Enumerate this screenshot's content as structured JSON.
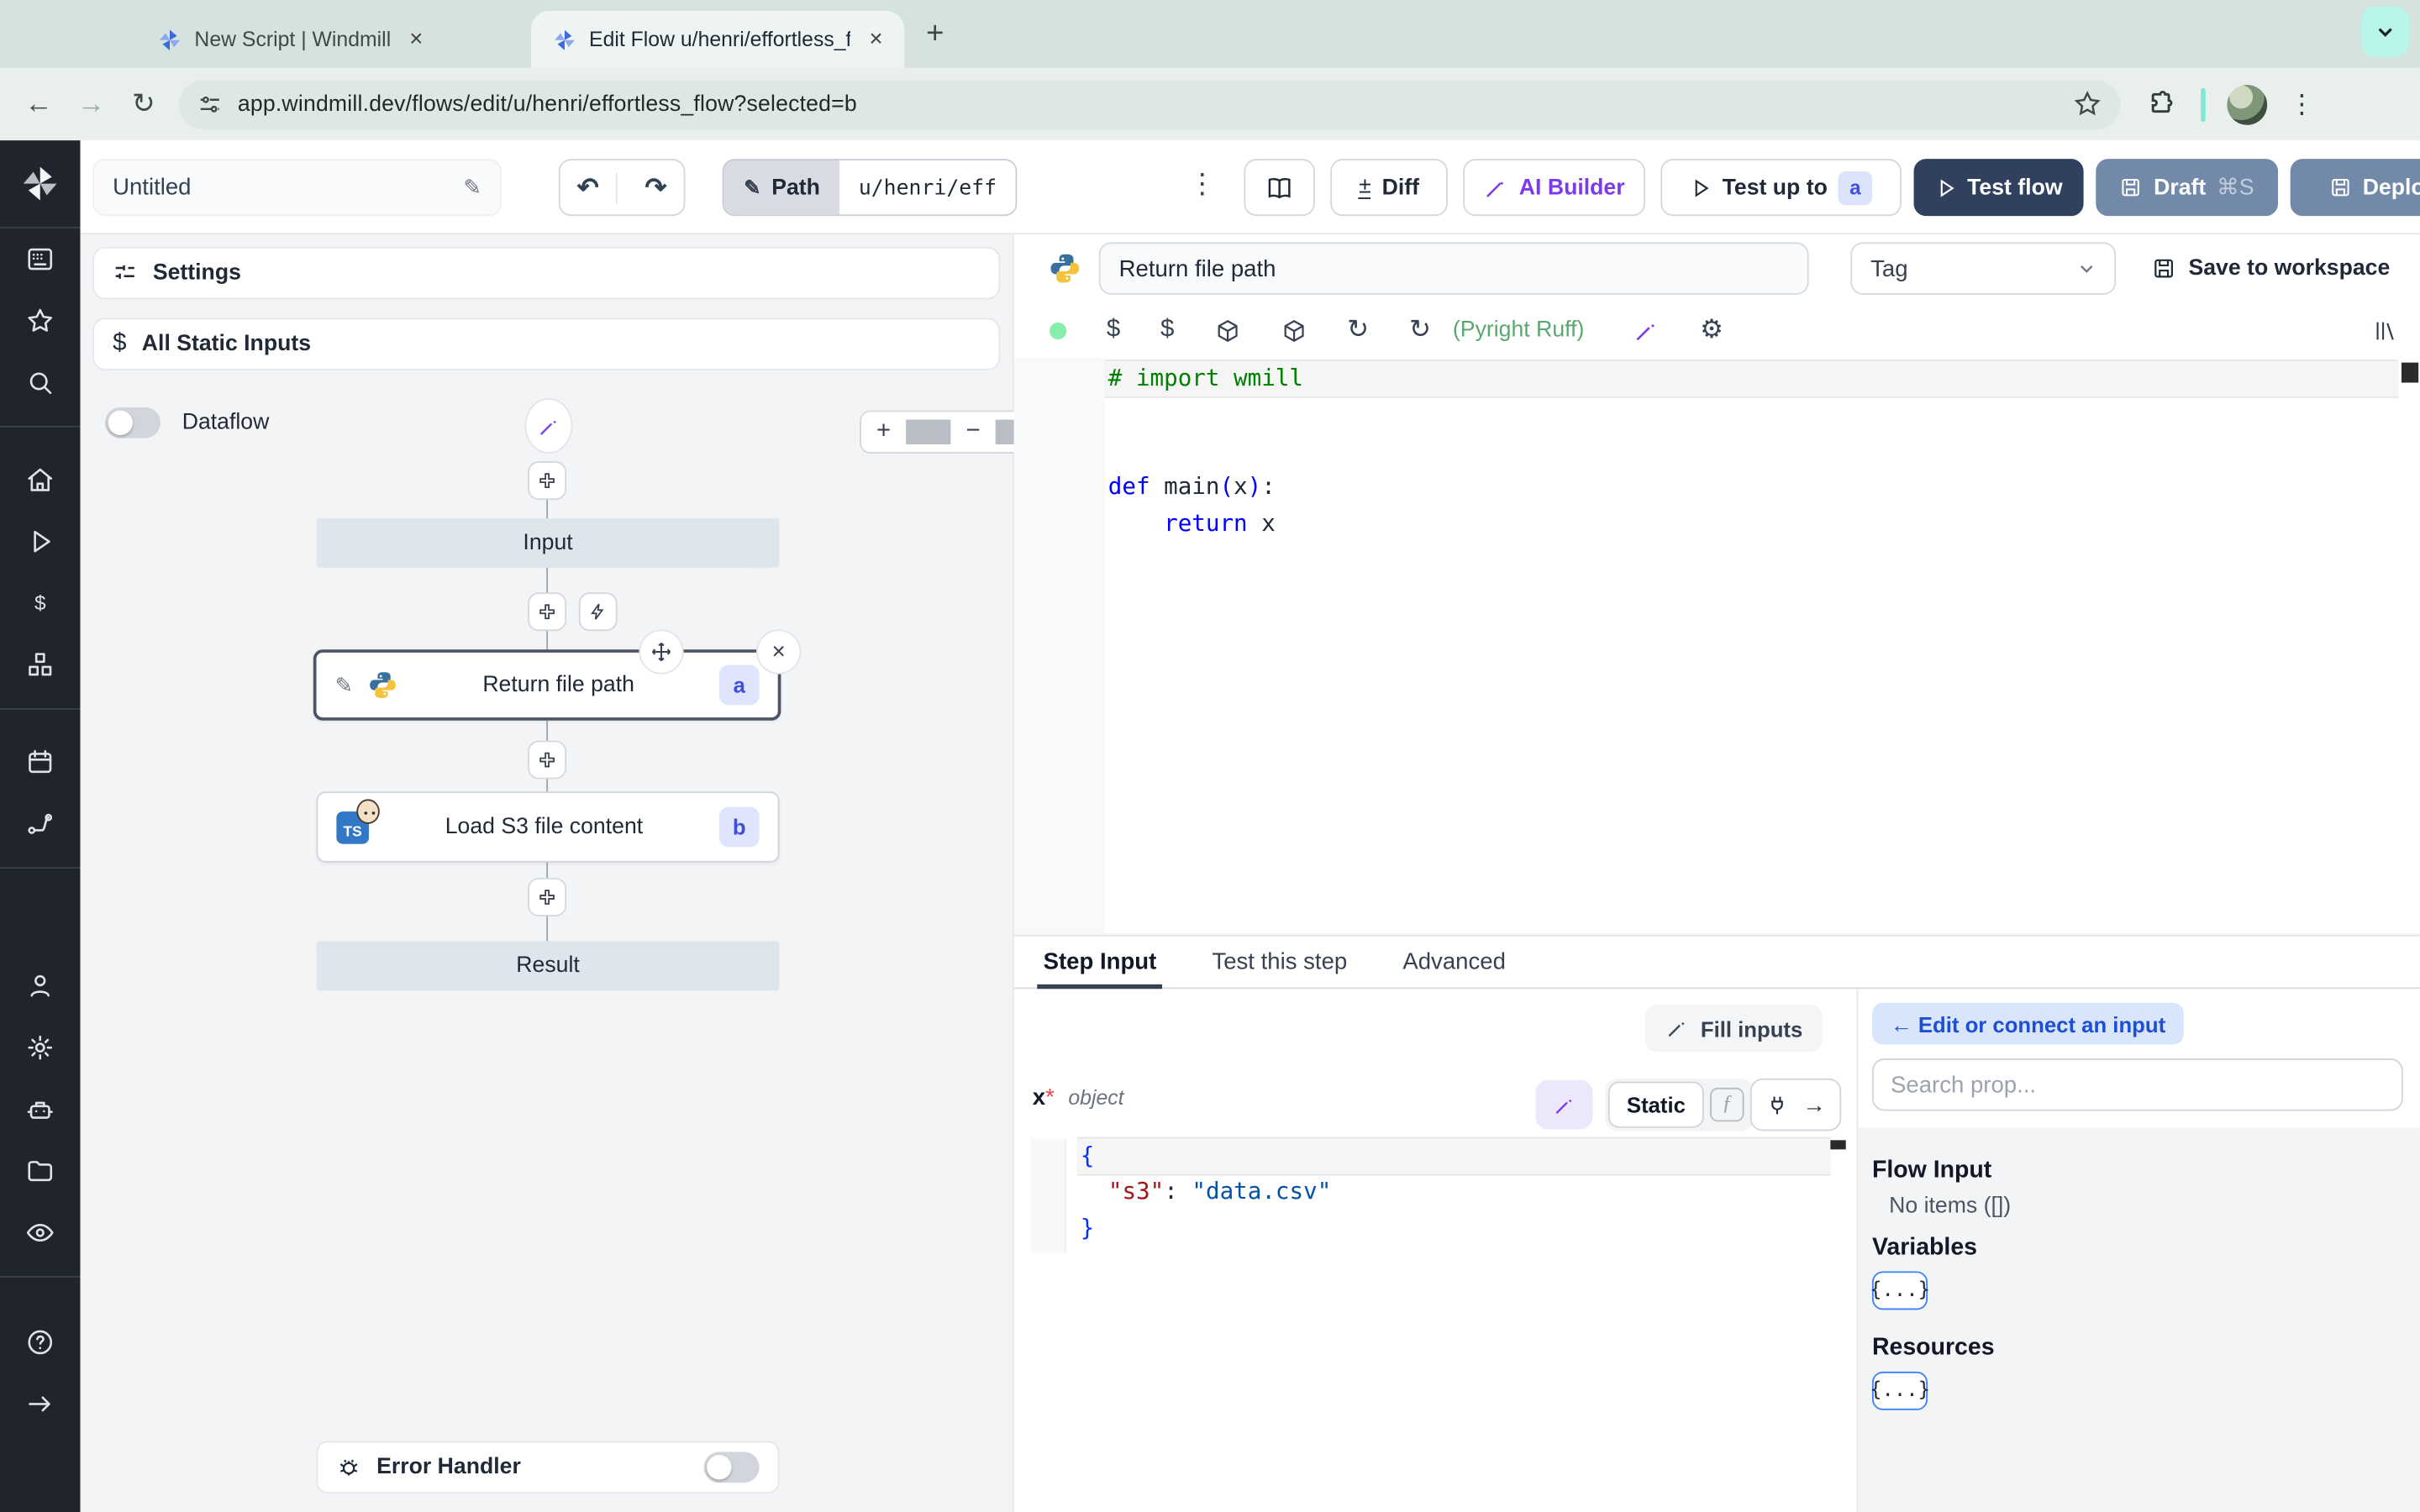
{
  "browser": {
    "tabs": [
      {
        "title": "New Script | Windmill"
      },
      {
        "title": "Edit Flow u/henri/effortless_fl"
      }
    ],
    "url": "app.windmill.dev/flows/edit/u/henri/effortless_flow?selected=b"
  },
  "topbar": {
    "flow_name": "Untitled",
    "path_label": "Path",
    "path_value": "u/henri/eff",
    "diff_label": "Diff",
    "ai_builder_label": "AI Builder",
    "test_up_to_label": "Test up to",
    "test_up_to_badge": "a",
    "test_flow_label": "Test flow",
    "draft_label": "Draft",
    "draft_shortcut": "⌘S",
    "deploy_label": "Deploy"
  },
  "flow_panel": {
    "settings_label": "Settings",
    "all_static_inputs_label": "All Static Inputs",
    "dataflow_label": "Dataflow",
    "input_node": "Input",
    "step_a_label": "Return file path",
    "step_a_badge": "a",
    "step_b_label": "Load S3 file content",
    "step_b_badge": "b",
    "result_node": "Result",
    "error_handler_label": "Error Handler"
  },
  "editor": {
    "step_name": "Return file path",
    "tag_placeholder": "Tag",
    "save_label": "Save to workspace",
    "lint_label": "(Pyright Ruff)",
    "code_lines": [
      {
        "hl": true,
        "tokens": [
          {
            "t": "# import wmill",
            "c": "comment"
          }
        ]
      },
      {
        "tokens": []
      },
      {
        "tokens": []
      },
      {
        "tokens": [
          {
            "t": "def",
            "c": "kw"
          },
          {
            "t": " main",
            "c": "plain"
          },
          {
            "t": "(",
            "c": "kw"
          },
          {
            "t": "x",
            "c": "plain"
          },
          {
            "t": ")",
            "c": "kw"
          },
          {
            "t": ":",
            "c": "plain"
          }
        ]
      },
      {
        "tokens": [
          {
            "t": "    ",
            "c": "plain"
          },
          {
            "t": "return",
            "c": "kw"
          },
          {
            "t": " x",
            "c": "plain"
          }
        ]
      }
    ]
  },
  "step_panel": {
    "tabs": [
      "Step Input",
      "Test this step",
      "Advanced"
    ],
    "active_tab": "Step Input",
    "fill_inputs_label": "Fill inputs",
    "arg_name": "x",
    "arg_required": "*",
    "arg_type": "object",
    "static_label": "Static",
    "json_lines": [
      {
        "hl": true,
        "tokens": [
          {
            "t": "{",
            "c": "brace"
          }
        ]
      },
      {
        "tokens": [
          {
            "t": "  ",
            "c": "plain"
          },
          {
            "t": "\"s3\"",
            "c": "key"
          },
          {
            "t": ": ",
            "c": "plain"
          },
          {
            "t": "\"data.csv\"",
            "c": "str"
          }
        ]
      },
      {
        "tokens": [
          {
            "t": "}",
            "c": "brace"
          }
        ]
      }
    ]
  },
  "prop_picker": {
    "connect_label": "← Edit or connect an input",
    "search_placeholder": "Search prop...",
    "sections": [
      {
        "title": "Flow Input",
        "empty": "No items ([])",
        "chip": ""
      },
      {
        "title": "Variables",
        "empty": "",
        "chip": "{...}"
      },
      {
        "title": "Resources",
        "empty": "",
        "chip": "{...}"
      }
    ]
  },
  "colors": {
    "accent_purple": "#7c3aed",
    "test_flow_bg": "#32405f",
    "deploy_bg": "#7289a9",
    "badge_bg": "#dbe3fb",
    "badge_text": "#3f4ed8",
    "lint_green": "#5aa870",
    "status_dot": "#86efac",
    "connect_chip_bg": "#d9e5fb",
    "connect_chip_text": "#1d4ed8",
    "sidebar_bg": "#20252d"
  }
}
